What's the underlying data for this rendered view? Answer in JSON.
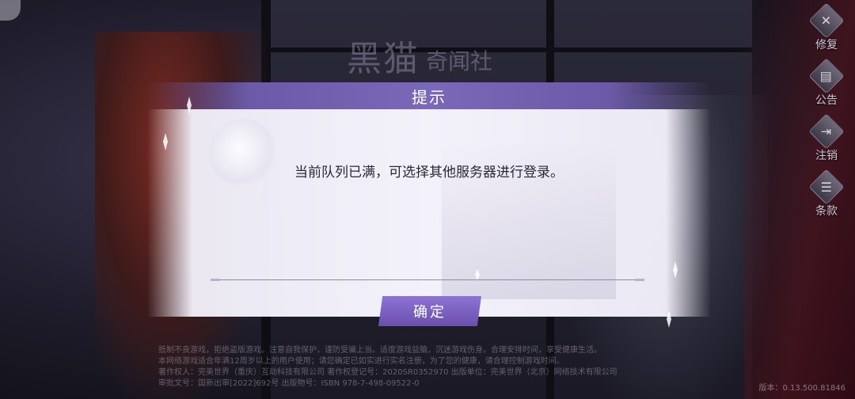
{
  "logo": {
    "main": "黑猫",
    "sub": "奇闻社"
  },
  "side_menu": [
    {
      "label": "修复",
      "icon": "wrench-icon",
      "glyph": "✕"
    },
    {
      "label": "公告",
      "icon": "notice-icon",
      "glyph": "▤"
    },
    {
      "label": "注销",
      "icon": "logout-icon",
      "glyph": "⇥"
    },
    {
      "label": "条款",
      "icon": "document-icon",
      "glyph": "☰"
    }
  ],
  "dialog": {
    "title": "提示",
    "message": "当前队列已满，可选择其他服务器进行登录。",
    "confirm_label": "确定"
  },
  "footer": {
    "line1": "抵制不良游戏，拒绝盗版游戏。注意自我保护，谨防受骗上当。适度游戏益脑，沉迷游戏伤身。合理安排时间，享受健康生活。",
    "line2": "本网络游戏适合年满12周岁以上的用户使用；请您确定已如实进行实名注册，为了您的健康，请合理控制游戏时间。",
    "line3": "著作权人：完美世界（重庆）互动科技有限公司    著作权登记号：2020SR0352970    出版单位：完美世界（北京）网络技术有限公司",
    "line4": "审批文号：国新出审[2022]692号    出版物号：ISBN 978-7-498-09522-0",
    "version": "版本：0.13.500.81846"
  }
}
